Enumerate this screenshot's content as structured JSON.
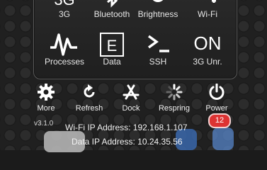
{
  "toggles_top": [
    {
      "label": "3G",
      "icon": "3g-icon"
    },
    {
      "label": "Bluetooth",
      "icon": "bluetooth-icon"
    },
    {
      "label": "Brightness",
      "icon": "brightness-icon"
    },
    {
      "label": "Wi-Fi",
      "icon": "wifi-icon"
    }
  ],
  "toggles_bottom": [
    {
      "label": "Processes",
      "icon": "processes-icon"
    },
    {
      "label": "Data",
      "icon": "data-icon",
      "glyph": "E"
    },
    {
      "label": "SSH",
      "icon": "terminal-icon",
      "glyph": ">_"
    },
    {
      "label": "3G Unr.",
      "icon": "on-text",
      "glyph": "ON"
    }
  ],
  "actions": [
    {
      "label": "More",
      "icon": "gear-icon"
    },
    {
      "label": "Refresh",
      "icon": "refresh-icon"
    },
    {
      "label": "Dock",
      "icon": "app-store-icon"
    },
    {
      "label": "Respring",
      "icon": "spinner-icon"
    },
    {
      "label": "Power",
      "icon": "power-icon"
    }
  ],
  "version": "v3.1.0",
  "wifi_ip": "Wi-Fi IP Address: 192.168.1.107",
  "data_ip": "Data IP Address: 10.24.35.56",
  "badge_count": "12"
}
